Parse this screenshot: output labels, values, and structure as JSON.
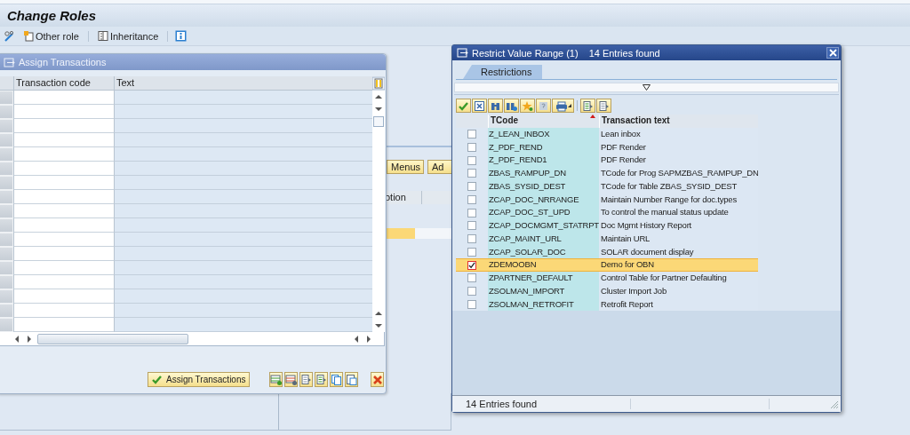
{
  "window": {
    "title": "Change Roles"
  },
  "toolbar": {
    "buttons": [
      {
        "label": "Other role"
      },
      {
        "label": "Inheritance"
      }
    ]
  },
  "background": {
    "buttons": [
      {
        "label": "Menus"
      },
      {
        "label": "Ad"
      }
    ],
    "column_header": "otion"
  },
  "assign_dialog": {
    "title": "Assign Transactions",
    "columns": [
      "Transaction code",
      "Text"
    ],
    "footer_button": "Assign Transactions"
  },
  "value_dialog": {
    "title": "Restrict Value Range (1)",
    "title_info": "14 Entries found",
    "tabs": [
      {
        "label": "Restrictions",
        "selected": true
      }
    ],
    "columns": [
      {
        "label": "TCode",
        "sorted": true
      },
      {
        "label": "Transaction text",
        "sorted": false
      }
    ],
    "rows": [
      {
        "tcode": "Z_LEAN_INBOX",
        "text": "Lean inbox",
        "checked": false
      },
      {
        "tcode": "Z_PDF_REND",
        "text": "PDF Render",
        "checked": false
      },
      {
        "tcode": "Z_PDF_REND1",
        "text": "PDF Render",
        "checked": false
      },
      {
        "tcode": "ZBAS_RAMPUP_DN",
        "text": "TCode for Prog SAPMZBAS_RAMPUP_DN",
        "checked": false
      },
      {
        "tcode": "ZBAS_SYSID_DEST",
        "text": "TCode for Table ZBAS_SYSID_DEST",
        "checked": false
      },
      {
        "tcode": "ZCAP_DOC_NRRANGE",
        "text": "Maintain Number Range for doc.types",
        "checked": false
      },
      {
        "tcode": "ZCAP_DOC_ST_UPD",
        "text": "To control the manual status update",
        "checked": false
      },
      {
        "tcode": "ZCAP_DOCMGMT_STATRPT",
        "text": "Doc Mgmt History Report",
        "checked": false
      },
      {
        "tcode": "ZCAP_MAINT_URL",
        "text": "Maintain URL",
        "checked": false
      },
      {
        "tcode": "ZCAP_SOLAR_DOC",
        "text": "SOLAR document display",
        "checked": false
      },
      {
        "tcode": "ZDEMOOBN",
        "text": "Demo for OBN",
        "checked": true
      },
      {
        "tcode": "ZPARTNER_DEFAULT",
        "text": "Control Table for Partner Defaulting",
        "checked": false
      },
      {
        "tcode": "ZSOLMAN_IMPORT",
        "text": "Cluster Import Job",
        "checked": false
      },
      {
        "tcode": "ZSOLMAN_RETROFIT",
        "text": "Retrofit Report",
        "checked": false
      }
    ],
    "status": "14 Entries found"
  }
}
